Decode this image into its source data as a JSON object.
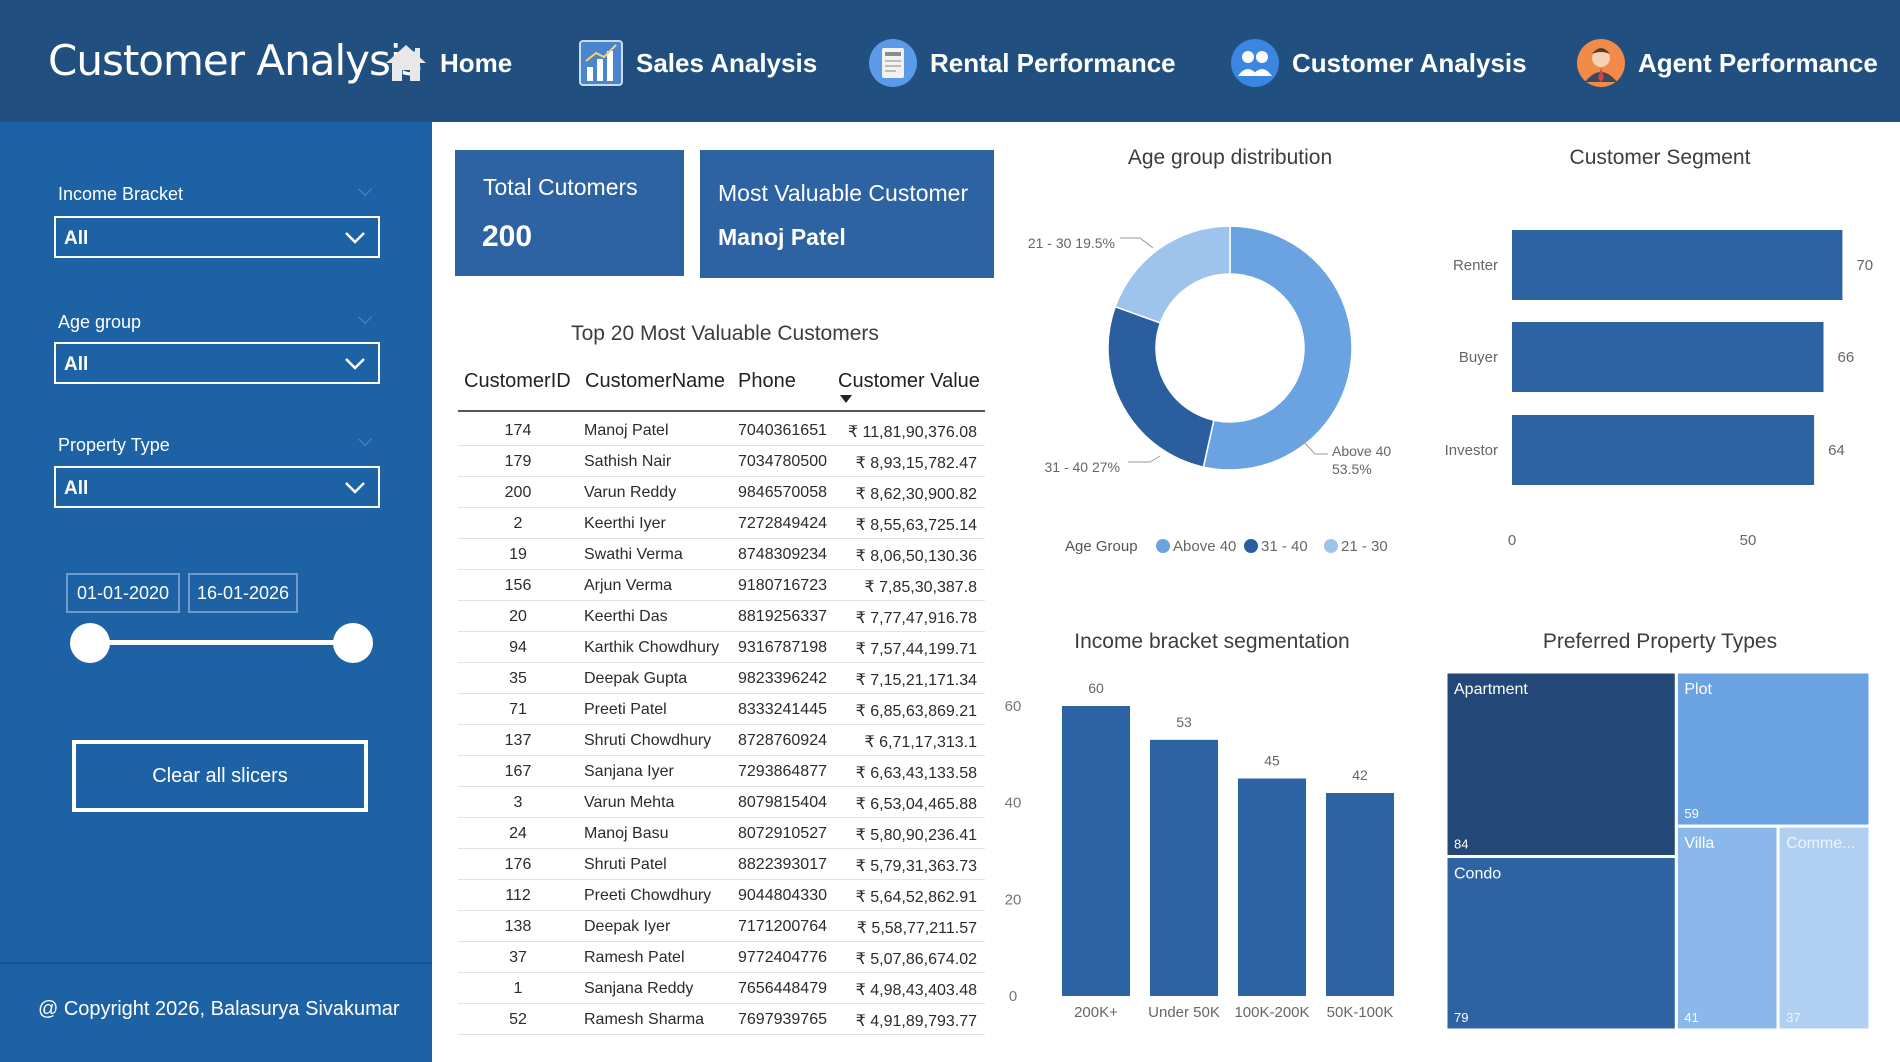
{
  "header": {
    "title": "Customer Analysis",
    "nav": [
      {
        "label": "Home",
        "icon": "home-icon"
      },
      {
        "label": "Sales Analysis",
        "icon": "bar-chart-icon"
      },
      {
        "label": "Rental Performance",
        "icon": "rental-document-icon"
      },
      {
        "label": "Customer Analysis",
        "icon": "users-icon"
      },
      {
        "label": "Agent Performance",
        "icon": "agent-avatar-icon"
      }
    ]
  },
  "sidebar": {
    "slicers": [
      {
        "label": "Income Bracket",
        "value": "All"
      },
      {
        "label": "Age group",
        "value": "All"
      },
      {
        "label": "Property Type",
        "value": "All"
      }
    ],
    "date_start": "01-01-2020",
    "date_end": "16-01-2026",
    "date_range_fraction": [
      0,
      1
    ],
    "clear_label": "Clear all slicers",
    "copyright": "@ Copyright 2026, Balasurya Sivakumar"
  },
  "kpis": {
    "total_label": "Total Cutomers",
    "total_value": "200",
    "mvc_label": "Most Valuable Customer",
    "mvc_value": "Manoj Patel"
  },
  "table": {
    "title": "Top 20 Most Valuable Customers",
    "columns": [
      "CustomerID",
      "CustomerName",
      "Phone",
      "Customer Value"
    ],
    "sort_column": "Customer Value",
    "rows": [
      [
        "174",
        "Manoj Patel",
        "7040361651",
        "₹ 11,81,90,376.08"
      ],
      [
        "179",
        "Sathish Nair",
        "7034780500",
        "₹ 8,93,15,782.47"
      ],
      [
        "200",
        "Varun Reddy",
        "9846570058",
        "₹ 8,62,30,900.82"
      ],
      [
        "2",
        "Keerthi Iyer",
        "7272849424",
        "₹ 8,55,63,725.14"
      ],
      [
        "19",
        "Swathi Verma",
        "8748309234",
        "₹ 8,06,50,130.36"
      ],
      [
        "156",
        "Arjun Verma",
        "9180716723",
        "₹ 7,85,30,387.8"
      ],
      [
        "20",
        "Keerthi Das",
        "8819256337",
        "₹ 7,77,47,916.78"
      ],
      [
        "94",
        "Karthik Chowdhury",
        "9316787198",
        "₹ 7,57,44,199.71"
      ],
      [
        "35",
        "Deepak Gupta",
        "9823396242",
        "₹ 7,15,21,171.34"
      ],
      [
        "71",
        "Preeti Patel",
        "8333241445",
        "₹ 6,85,63,869.21"
      ],
      [
        "137",
        "Shruti Chowdhury",
        "8728760924",
        "₹ 6,71,17,313.1"
      ],
      [
        "167",
        "Sanjana Iyer",
        "7293864877",
        "₹ 6,63,43,133.58"
      ],
      [
        "3",
        "Varun Mehta",
        "8079815404",
        "₹ 6,53,04,465.88"
      ],
      [
        "24",
        "Manoj Basu",
        "8072910527",
        "₹ 5,80,90,236.41"
      ],
      [
        "176",
        "Shruti Patel",
        "8822393017",
        "₹ 5,79,31,363.73"
      ],
      [
        "112",
        "Preeti Chowdhury",
        "9044804330",
        "₹ 5,64,52,862.91"
      ],
      [
        "138",
        "Deepak Iyer",
        "7171200764",
        "₹ 5,58,77,211.57"
      ],
      [
        "37",
        "Ramesh Patel",
        "9772404776",
        "₹ 5,07,86,674.02"
      ],
      [
        "1",
        "Sanjana Reddy",
        "7656448479",
        "₹ 4,98,43,403.48"
      ],
      [
        "52",
        "Ramesh Sharma",
        "7697939765",
        "₹ 4,91,89,793.77"
      ]
    ]
  },
  "chart_data": [
    {
      "type": "pie",
      "title": "Age group distribution",
      "legend_title": "Age Group",
      "legend_position": "bottom",
      "labels": [
        "Above 40",
        "31 - 40",
        "21 - 30"
      ],
      "values": [
        53.5,
        27,
        19.5
      ],
      "data_labels": [
        "Above 40 53.5%",
        "31 - 40 27%",
        "21 - 30 19.5%"
      ],
      "colors": [
        "#6aa2e2",
        "#2a5e9e",
        "#9ec4ed"
      ]
    },
    {
      "type": "bar",
      "orientation": "horizontal",
      "title": "Customer Segment",
      "categories": [
        "Renter",
        "Buyer",
        "Investor"
      ],
      "values": [
        70,
        66,
        64
      ],
      "xticks": [
        "0",
        "50"
      ],
      "xlim": [
        0,
        75
      ],
      "color": "#2d63a3"
    },
    {
      "type": "bar",
      "title": "Income bracket segmentation",
      "categories": [
        "200K+",
        "Under 50K",
        "100K-200K",
        "50K-100K"
      ],
      "values": [
        60,
        53,
        45,
        42
      ],
      "yticks": [
        "0",
        "20",
        "40",
        "60"
      ],
      "ylim": [
        0,
        60
      ],
      "color": "#2d63a3"
    },
    {
      "type": "treemap",
      "title": "Preferred Property Types",
      "labels": [
        "Apartment",
        "Condo",
        "Plot",
        "Villa",
        "Comme..."
      ],
      "values": [
        84,
        79,
        59,
        41,
        37
      ],
      "colors": [
        "#234776",
        "#2d63a3",
        "#6aa2e2",
        "#8ab8ea",
        "#b1d0f1"
      ]
    }
  ]
}
